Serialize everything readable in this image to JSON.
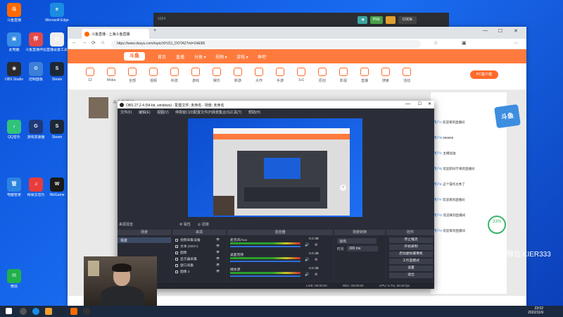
{
  "desktop": {
    "icons": [
      {
        "label": "斗鱼直播",
        "color": "#ff6a00",
        "glyph": "斗"
      },
      {
        "label": "Microsoft Edge",
        "color": "#1b8ce0",
        "glyph": "e"
      },
      {
        "label": "此电脑",
        "color": "#3a8ee6",
        "glyph": "▣"
      },
      {
        "label": "斗鱼直播伴侣",
        "color": "#e24a4a",
        "glyph": "伴"
      },
      {
        "label": "直播设置工具",
        "color": "#eeeeee",
        "glyph": "▤"
      },
      {
        "label": "OBS Studio",
        "color": "#2b2b2b",
        "glyph": "◉"
      },
      {
        "label": "控制面板",
        "color": "#3b7fd8",
        "glyph": "⚙"
      },
      {
        "label": "Steam",
        "color": "#1b2838",
        "glyph": "S"
      },
      {
        "label": "QQ音乐",
        "color": "#31c27c",
        "glyph": "♪"
      },
      {
        "label": "游戏加速器",
        "color": "#1e3a7a",
        "glyph": "G"
      },
      {
        "label": "Steam",
        "color": "#1b2838",
        "glyph": "S"
      },
      {
        "label": "电脑管家",
        "color": "#2c84e0",
        "glyph": "管"
      },
      {
        "label": "网易云音乐",
        "color": "#e83c3c",
        "glyph": "♫"
      },
      {
        "label": "WeGame",
        "color": "#1a1a1a",
        "glyph": "W"
      },
      {
        "label": "微信",
        "color": "#22b04a",
        "glyph": "✉"
      }
    ]
  },
  "topbar": {
    "title": "1024",
    "chip1": "◀",
    "chip2": "PRE",
    "chip3": "CODE"
  },
  "browser": {
    "tab_title": "斗鱼直播 - 上海斗鱼直播",
    "new_tab": "+",
    "url": "https://www.douyu.com/topic/XHJ11_DOTA2?rid=24&l95",
    "min": "—",
    "max": "☐",
    "close": "✕"
  },
  "site": {
    "logo": "斗鱼",
    "nav": [
      "首页",
      "直播",
      "分类 ▾",
      "视频 ▾",
      "游戏 ▾",
      "鱼吧"
    ],
    "categories": [
      "12",
      "Moba",
      "全部",
      "视频",
      "科技",
      "游戏",
      "娱乐",
      "新游",
      "大作",
      "手游",
      "1v1",
      "原创",
      "影视",
      "直播",
      "搜索",
      "活动"
    ],
    "pc_button": "PC客户端",
    "room_title": "斗鱼直播间",
    "chat_lines": [
      {
        "name": "用户A",
        "text": "欢迎来到直播间"
      },
      {
        "name": "用户B",
        "text": "666666"
      },
      {
        "name": "用户C",
        "text": "主播加油"
      },
      {
        "name": "用户D",
        "text": "欢迎新同学来到直播间"
      },
      {
        "name": "用户E",
        "text": "这个操作太秀了"
      },
      {
        "name": "用户F",
        "text": "欢迎来到直播间"
      },
      {
        "name": "用户G",
        "text": "欢迎来到直播间"
      },
      {
        "name": "用户H",
        "text": "欢迎来到直播间"
      }
    ]
  },
  "obs": {
    "title": "OBS 27.2.4 (64-bit, windows) - 配置文件: 未命名 - 场景: 未命名",
    "menu": [
      "文件(F)",
      "编辑(E)",
      "视图(V)",
      "停靠窗口(D)",
      "配置文件(P)",
      "场景集合(S)",
      "工具(T)",
      "帮助(H)"
    ],
    "audio_label": "来源混音",
    "docks": {
      "scenes": "场景",
      "sources": "来源",
      "mixer": "混音器",
      "transitions": "场景转换",
      "controls": "控件"
    },
    "scene_item": "场景",
    "sources": [
      "视频采集设备",
      "文本 (GDI+)",
      "图像",
      "显示器采集",
      "窗口采集",
      "图像 2"
    ],
    "mixer_tracks": [
      {
        "name": "麦克风/Aux",
        "db": "0.0 dB"
      },
      {
        "name": "桌面音频",
        "db": "0.0 dB"
      },
      {
        "name": "媒体源",
        "db": "0.0 dB"
      }
    ],
    "transition": {
      "type": "淡出",
      "duration_label": "时长",
      "duration": "300 ms"
    },
    "controls": [
      "停止推流",
      "开始录制",
      "启动虚拟摄像机",
      "工作室模式",
      "设置",
      "退出"
    ],
    "status": {
      "live": "LIVE: 00:00:00",
      "rec": "REC: 00:00:00",
      "cpu": "CPU: 0.7%, 60.00 fps"
    }
  },
  "overlay": {
    "watermark": "微信 KIER333",
    "speed_value": "33",
    "speed_unit": "%",
    "badge": "斗鱼"
  },
  "taskbar": {
    "time": "23:02",
    "date": "2022/11/9"
  }
}
